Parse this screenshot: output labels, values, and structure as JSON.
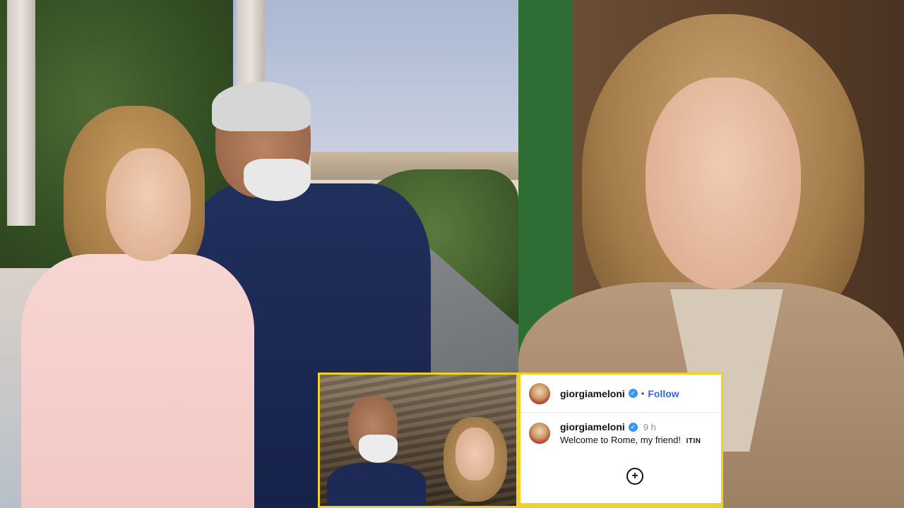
{
  "instagram_post": {
    "header": {
      "username": "giorgiameloni",
      "separator": "•",
      "follow_label": "Follow"
    },
    "comment": {
      "username": "giorgiameloni",
      "time": "9 h",
      "text": "Welcome to Rome, my friend!",
      "flags_text": "ITIN"
    },
    "add_icon": "plus-circle-icon"
  },
  "colors": {
    "highlight_border": "#f2d027",
    "verified_badge": "#3897f0",
    "follow_link": "#3b66d6"
  }
}
